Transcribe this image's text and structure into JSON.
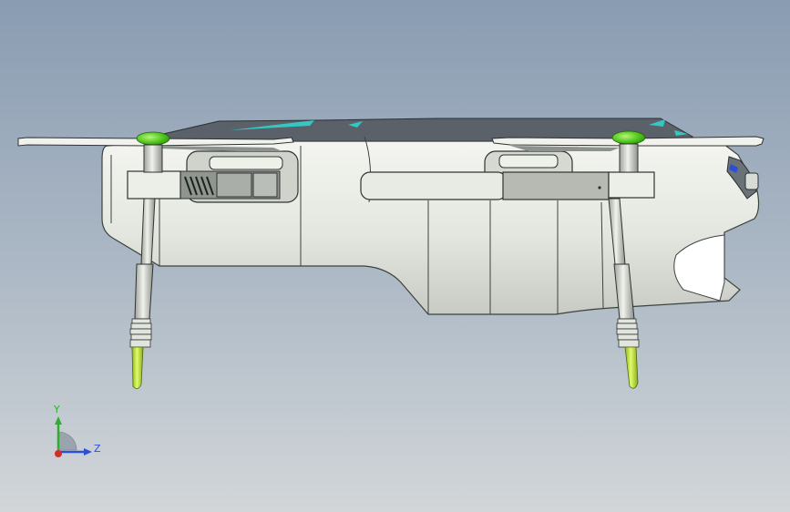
{
  "viewport": {
    "background_top": "#8a9cb2",
    "background_bottom": "#d2d6d9"
  },
  "model": {
    "body_color": "#e4e7e0",
    "hub_color": "#5fd42a",
    "accent_color": "#36c7c4",
    "foot_color": "#c4ee3c"
  },
  "triad": {
    "y_label": "Y",
    "z_label": "Z",
    "y_color": "#2fae2f",
    "z_color": "#2c4fd6",
    "x_color": "#d62c2c"
  }
}
